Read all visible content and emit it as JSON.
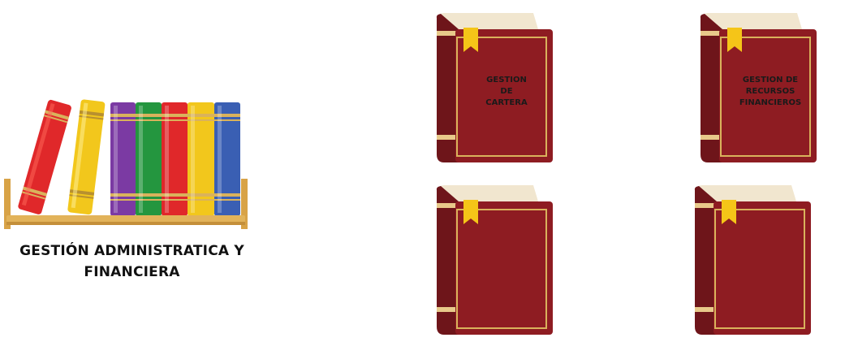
{
  "title": "GESTIÓN ADMINISTRATICA Y FINANCIERA",
  "books": [
    {
      "label": "GESTION\nDE\nCARTERA"
    },
    {
      "label": "GESTION DE\nRECURSOS\nFINANCIEROS"
    },
    {
      "label": ""
    },
    {
      "label": ""
    }
  ],
  "colors": {
    "book_cover": "#8e1c22",
    "book_spine": "#6e151a",
    "book_pages": "#f1e6cf",
    "bookmark": "#f5c518",
    "frame": "#d9b25c",
    "shelf": "#e2b35a"
  },
  "icons": [
    "bookshelf-illustration",
    "book-icon",
    "bookmark-icon"
  ]
}
